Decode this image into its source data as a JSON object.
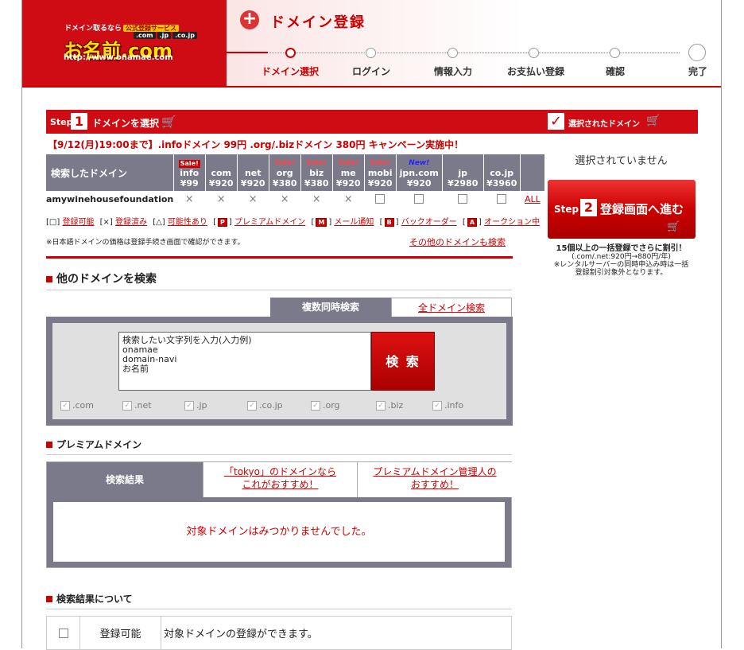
{
  "logo": {
    "tag1": "ドメイン取るなら",
    "tag1b": "公式登録サービス",
    "tlds": [
      ".com",
      ".jp",
      ".co.jp"
    ],
    "brand": "お名前.com",
    "url": "http://www.onamae.com"
  },
  "header": {
    "title": "ドメイン登録",
    "steps": [
      "ドメイン選択",
      "ログイン",
      "情報入力",
      "お支払い登録",
      "確認",
      "完了"
    ]
  },
  "step1": {
    "step_label": "Step",
    "step_num": "1",
    "title": "ドメインを選択"
  },
  "campaign": "【9/12(月)19:00まで】.infoドメイン 99円 .org/.bizドメイン 380円 キャンペーン実施中！",
  "domain_table": {
    "header_label": "検索したドメイン",
    "columns": [
      {
        "badge": "Sale!",
        "badge_style": "box",
        "tld": "info",
        "price": "¥99"
      },
      {
        "badge": "",
        "badge_style": "",
        "tld": "com",
        "price": "¥920"
      },
      {
        "badge": "",
        "badge_style": "",
        "tld": "net",
        "price": "¥920"
      },
      {
        "badge": "Sale!",
        "badge_style": "sale",
        "tld": "org",
        "price": "¥380"
      },
      {
        "badge": "Sale!",
        "badge_style": "sale",
        "tld": "biz",
        "price": "¥380"
      },
      {
        "badge": "Sale!",
        "badge_style": "sale",
        "tld": "me",
        "price": "¥920"
      },
      {
        "badge": "Sale!",
        "badge_style": "sale",
        "tld": "mobi",
        "price": "¥920"
      },
      {
        "badge": "New!",
        "badge_style": "new",
        "tld": "jpn.com",
        "price": "¥920"
      },
      {
        "badge": "",
        "badge_style": "",
        "tld": "jp",
        "price": "¥2980"
      },
      {
        "badge": "",
        "badge_style": "",
        "tld": "co.jp",
        "price": "¥3960"
      }
    ],
    "domain": "amywinehousefoundation",
    "row_states": [
      "×",
      "×",
      "×",
      "×",
      "×",
      "×",
      "box",
      "box",
      "box",
      "box"
    ],
    "all_link": "ALL"
  },
  "legend": {
    "items": [
      {
        "mark": "[□]",
        "label": "登録可能"
      },
      {
        "mark": "[×]",
        "label": "登録済み"
      },
      {
        "mark": "[△]",
        "label": "可能性あり"
      },
      {
        "mark": "P",
        "label": "プレミアムドメイン"
      },
      {
        "mark": "M",
        "label": "メール通知"
      },
      {
        "mark": "B",
        "label": "バックオーダー"
      },
      {
        "mark": "A",
        "label": "オークション中"
      }
    ]
  },
  "note": "※日本語ドメインの価格は登録手続き画面で確認ができます。",
  "other_search_link": "その他のドメインも検索",
  "other_search": {
    "title": "他のドメインを検索",
    "tab_multi": "複数同時検索",
    "tab_all": "全ドメイン検索",
    "textarea": "検索したい文字列を入力(入力例)\nonamae\ndomain-navi\nお名前",
    "search_button": "検 索",
    "tlds": [
      ".com",
      ".net",
      ".jp",
      ".co.jp",
      ".org",
      ".biz",
      ".info"
    ]
  },
  "premium": {
    "title": "プレミアムドメイン",
    "tab1": "検索結果",
    "tab2_line1": "「tokyo」のドメインなら",
    "tab2_line2": "これがおすすめ！",
    "tab3_line1": "プレミアムドメイン管理人の",
    "tab3_line2": "おすすめ！",
    "empty_msg": "対象ドメインはみつかりませんでした。"
  },
  "about": {
    "title": "検索結果について",
    "row1_label": "登録可能",
    "row1_desc": "対象ドメインの登録ができます。"
  },
  "sidebar": {
    "head": "選択されたドメイン",
    "not_selected": "選択されていません",
    "go_step_label": "Step",
    "go_step_num": "2",
    "go_label": "登録画面へ進む",
    "discount_bold": "15個以上の一括登録でさらに割引！",
    "discount_line2": "(.com/.net:920円→880円/年)",
    "discount_line3": "※レンタルサーバーの同時申込み時は一括",
    "discount_line4": "登録割引対象外となります。"
  },
  "colors": {
    "brand_red": "#cf0c13",
    "table_gray": "#7a7a8b"
  }
}
